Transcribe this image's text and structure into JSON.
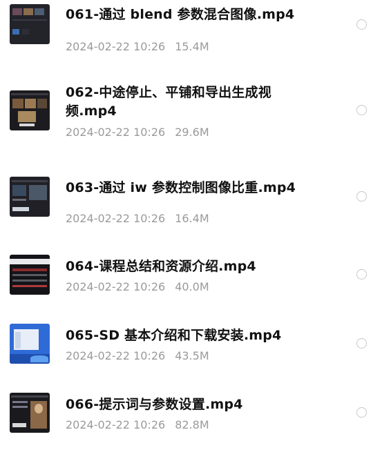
{
  "files": [
    {
      "name": "061-通过 blend 参数混合图像.mp4",
      "date": "2024-02-22 10:26",
      "size": "15.4M"
    },
    {
      "name": "062-中途停止、平铺和导出生成视频.mp4",
      "date": "2024-02-22 10:26",
      "size": "29.6M"
    },
    {
      "name": "063-通过 iw 参数控制图像比重.mp4",
      "date": "2024-02-22 10:26",
      "size": "16.4M"
    },
    {
      "name": "064-课程总结和资源介绍.mp4",
      "date": "2024-02-22 10:26",
      "size": "40.0M"
    },
    {
      "name": "065-SD 基本介绍和下载安装.mp4",
      "date": "2024-02-22 10:26",
      "size": "43.5M"
    },
    {
      "name": "066-提示词与参数设置.mp4",
      "date": "2024-02-22 10:26",
      "size": "82.8M"
    }
  ],
  "colors": {
    "title": "#111111",
    "meta": "#9a9a9a",
    "radio_border": "#c8c8c8"
  }
}
